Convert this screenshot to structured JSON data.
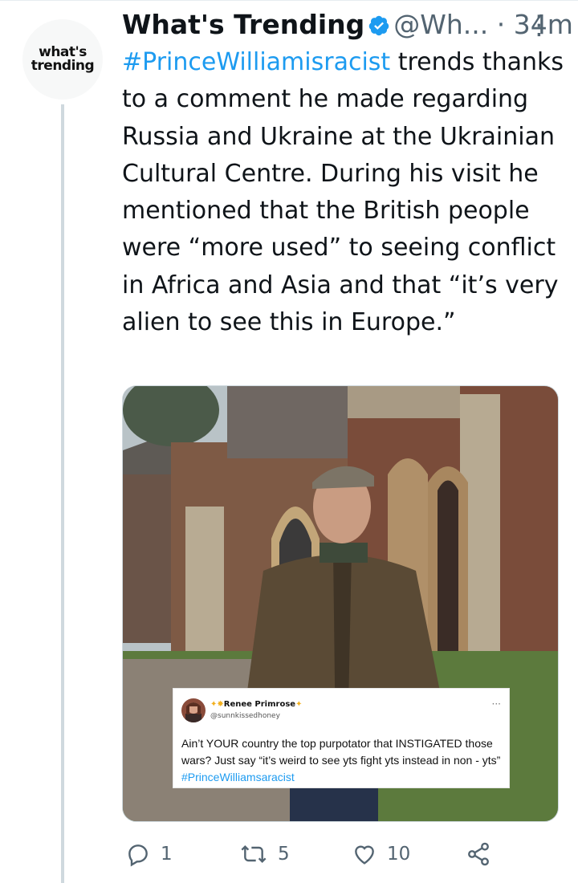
{
  "tweet": {
    "author": {
      "name": "What's Trending",
      "handle": "@Wh...",
      "time": "34m",
      "avatar_line1": "what's",
      "avatar_line2": "trending"
    },
    "separator": "·",
    "more": "⋮",
    "text_hashtag": "#PrinceWilliamisracist",
    "text_body": " trends thanks to a comment he made regarding Russia and Ukraine at the Ukrainian Cultural Centre. During his visit he mentioned that the British people were “more used” to seeing conflict in Africa and Asia and that “it’s very alien to see this in Europe.”",
    "embed": {
      "name": "Renee Primrose",
      "handle": "@sunnkissedhoney",
      "dots": "···",
      "text_main": "Ain’t YOUR country the top purpotator that INSTIGATED those wars? Just say “it’s weird to see yts fight yts instead in non - yts” ",
      "text_hashtag": "#PrinceWilliamsaracist"
    },
    "actions": {
      "replies": "1",
      "retweets": "5",
      "likes": "10"
    },
    "colors": {
      "link": "#1d9bf0",
      "muted": "#536471",
      "verified": "#1d9bf0"
    }
  }
}
